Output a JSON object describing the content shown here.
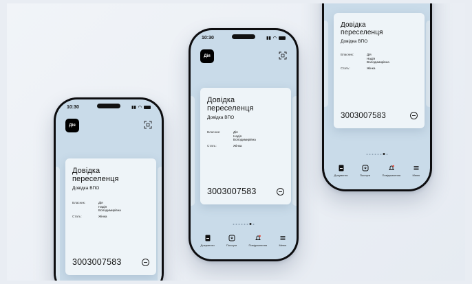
{
  "status": {
    "time": "10:30"
  },
  "app": {
    "logo_text": "Дія"
  },
  "document": {
    "title_line1": "Довідка",
    "title_line2": "переселенця",
    "subtitle": "Довідка ВПО",
    "owner_label": "Власник:",
    "owner_value_1": "Дія",
    "owner_value_2": "Надія",
    "owner_value_3": "Володимирівна",
    "gender_label": "Стать:",
    "gender_value": "Жінка",
    "number": "3003007583"
  },
  "tabs": [
    {
      "label": "Документи",
      "icon": "document-icon"
    },
    {
      "label": "Послуги",
      "icon": "services-icon"
    },
    {
      "label": "Повідомлення",
      "icon": "bell-icon"
    },
    {
      "label": "Меню",
      "icon": "menu-icon"
    }
  ],
  "colors": {
    "screen": "#c9dbe9",
    "card": "#eef4f8",
    "accent": "#e5483a"
  }
}
